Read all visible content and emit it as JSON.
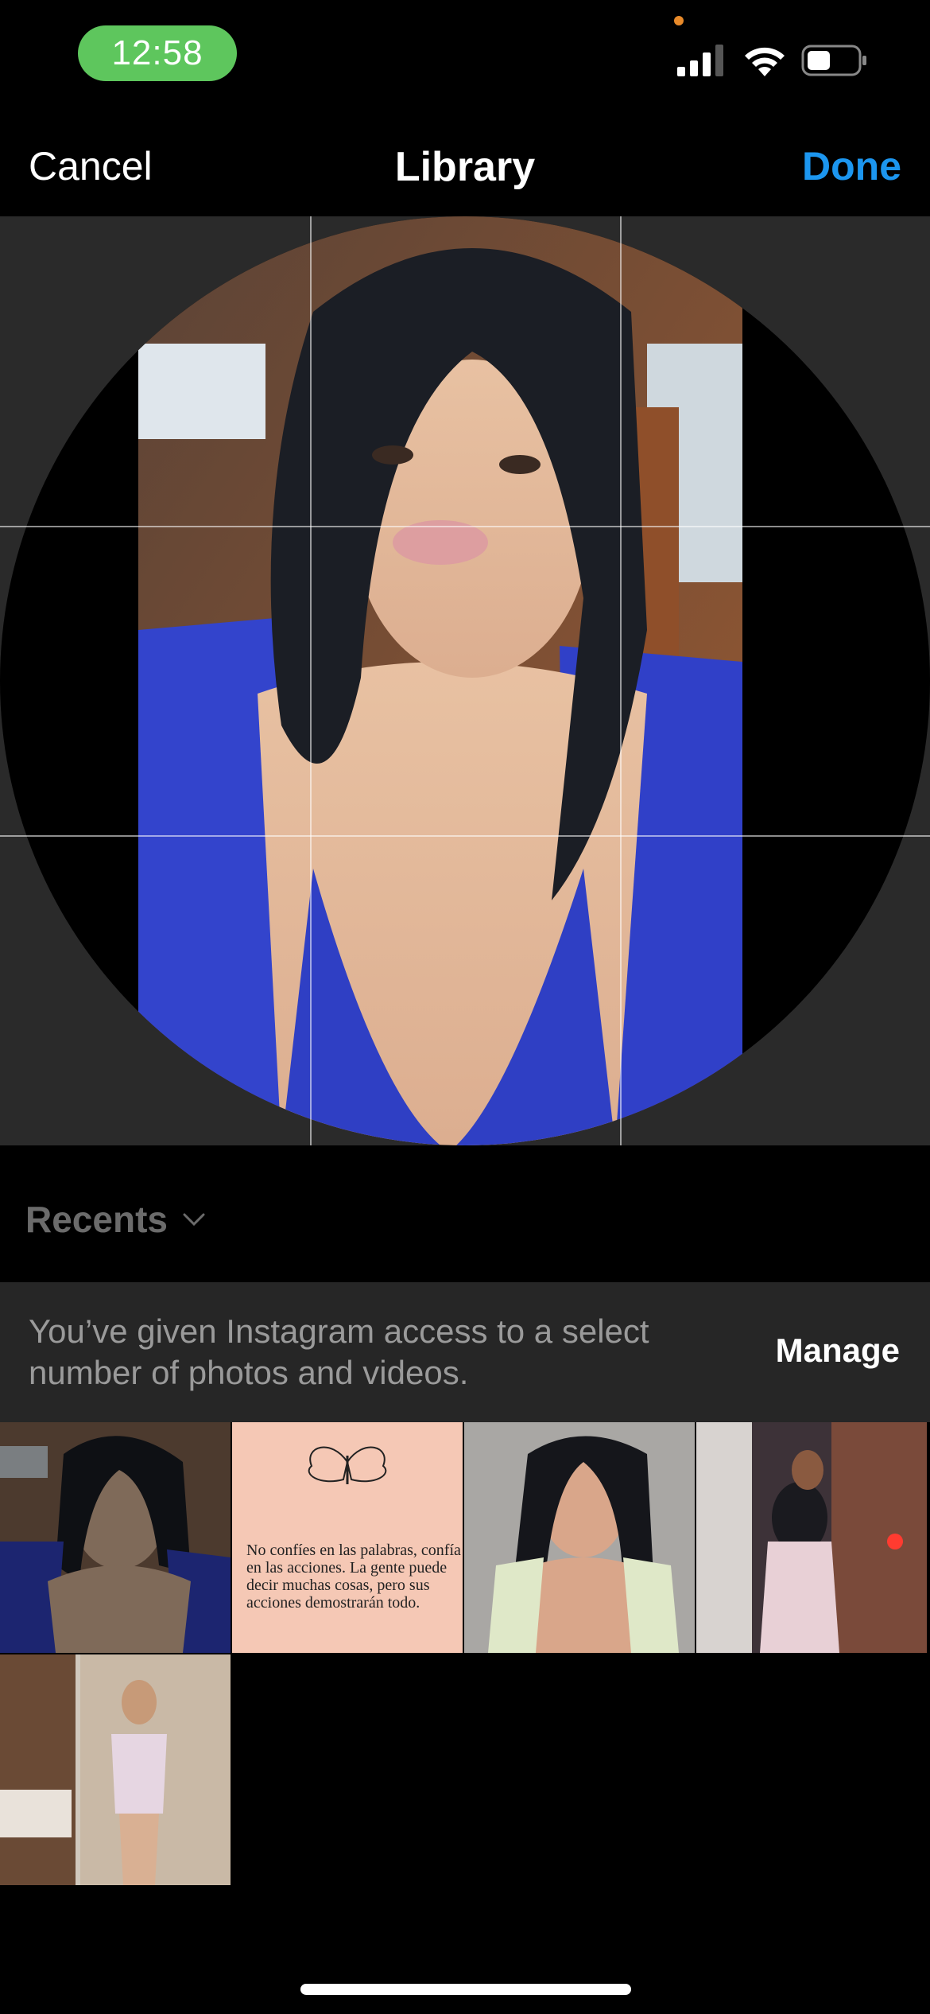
{
  "status_bar": {
    "time": "12:58",
    "time_pill_color": "#5ec65d",
    "icons": [
      "signal-icon",
      "wifi-icon",
      "battery-icon"
    ]
  },
  "nav": {
    "cancel_label": "Cancel",
    "title": "Library",
    "done_label": "Done",
    "done_color": "#1c96ef"
  },
  "album": {
    "label": "Recents"
  },
  "access_banner": {
    "message": "You’ve given Instagram access to a select number of photos and videos.",
    "manage_label": "Manage"
  },
  "thumbnails": {
    "quote_text": "No confíes en las palabras, confía en las acciones. La gente puede decir muchas cosas, pero sus acciones demostrarán todo."
  }
}
